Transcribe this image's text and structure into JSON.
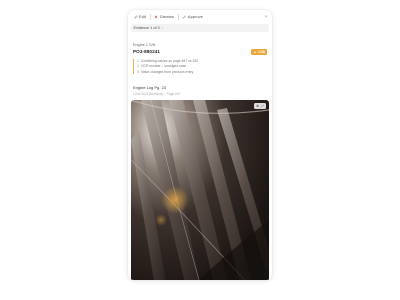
{
  "toolbar": {
    "edit_label": "Edit",
    "dismiss_label": "Dismiss",
    "approve_label": "Approve"
  },
  "evidence": {
    "label": "Evidence 1 of 3"
  },
  "section1": {
    "label": "Engine 1 S/N",
    "po_number": "PO3-880241",
    "badge": "LOW",
    "issues": [
      {
        "n": "1",
        "text": "Conflicting values on page 847 vs 332"
      },
      {
        "n": "2",
        "text": "OCR unclear – smudged scan"
      },
      {
        "n": "3",
        "text": "Value changed from previous entry"
      }
    ]
  },
  "section2": {
    "title": "Engine Log Pg. 23",
    "subtitle": "12/4/2024 (Nominal) – Page 847"
  },
  "colors": {
    "accent": "#e8a73a",
    "photo_dark": "#241c1a"
  }
}
